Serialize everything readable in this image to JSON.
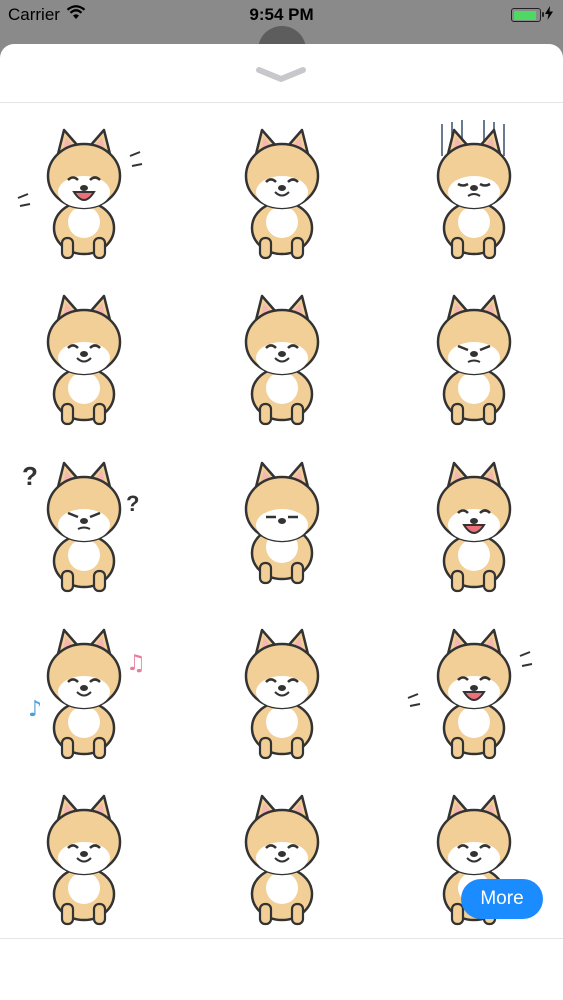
{
  "status_bar": {
    "carrier": "Carrier",
    "time": "9:54 PM"
  },
  "sheet": {
    "collapse_icon": "chevron-down-icon"
  },
  "stickers": [
    {
      "name": "sticker-dog-laughing-shaking"
    },
    {
      "name": "sticker-dog-happy-sitting"
    },
    {
      "name": "sticker-dog-gloomy"
    },
    {
      "name": "sticker-dog-content-lying"
    },
    {
      "name": "sticker-dog-smiling-standing"
    },
    {
      "name": "sticker-dog-grumpy-sitting"
    },
    {
      "name": "sticker-dog-confused"
    },
    {
      "name": "sticker-dog-sleeping"
    },
    {
      "name": "sticker-dog-excited-walking"
    },
    {
      "name": "sticker-dog-singing"
    },
    {
      "name": "sticker-dog-playful-bow"
    },
    {
      "name": "sticker-dog-big-laugh"
    },
    {
      "name": "sticker-dog-standing-up"
    },
    {
      "name": "sticker-dog-sitting-smile"
    },
    {
      "name": "sticker-dog-peeking"
    }
  ],
  "more_button": {
    "label": "More",
    "color": "#1a8cff"
  },
  "colors": {
    "fur": "#f2cf96",
    "fur_dark": "#e7b774",
    "belly": "#ffffff",
    "outline": "#333333",
    "ear_inner": "#f6b6b2",
    "tongue": "#ee6e7a"
  }
}
